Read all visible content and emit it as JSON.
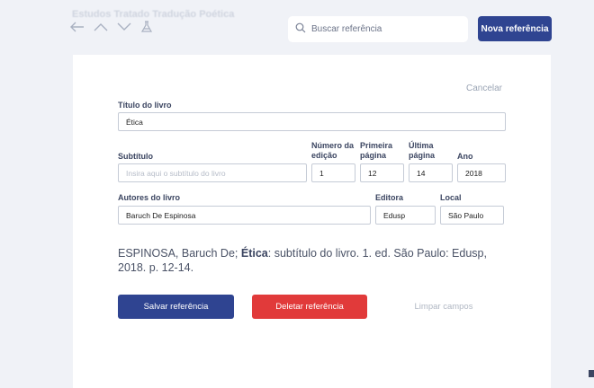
{
  "header": {
    "title": "Estudos Tratado Tradução Poética"
  },
  "search": {
    "placeholder": "Buscar referência",
    "value": ""
  },
  "toolbar": {
    "new_reference_label": "Nova referência"
  },
  "form": {
    "cancel_label": "Cancelar",
    "book_title": {
      "label": "Título do livro",
      "value": "Ética"
    },
    "subtitle": {
      "label": "Subtítulo",
      "value": "",
      "placeholder": "Insira aqui o subtítulo do livro"
    },
    "edition": {
      "label_line1": "Número da",
      "label_line2": "edição",
      "value": "1"
    },
    "first_page": {
      "label_line1": "Primeira",
      "label_line2": "página",
      "value": "12"
    },
    "last_page": {
      "label_line1": "Última",
      "label_line2": "página",
      "value": "14"
    },
    "year": {
      "label": "Ano",
      "value": "2018"
    },
    "authors": {
      "label": "Autores do livro",
      "value": "Baruch De Espinosa"
    },
    "publisher": {
      "label": "Editora",
      "value": "Edusp"
    },
    "location": {
      "label": "Local",
      "value": "São Paulo"
    }
  },
  "citation": {
    "before": "ESPINOSA, Baruch De; ",
    "title": "Ética",
    "after": ": subtítulo do livro. 1. ed. São Paulo: Edusp, 2018. p. 12-14."
  },
  "actions": {
    "save_label": "Salvar referência",
    "delete_label": "Deletar referência",
    "clear_label": "Limpar campos"
  },
  "icons": [
    "back-arrow-icon",
    "chevron-up-icon",
    "chevron-down-icon",
    "flask-icon",
    "search-icon"
  ],
  "colors": {
    "primary": "#2f4491",
    "danger": "#e13a3a",
    "background": "#f0f2f7"
  }
}
